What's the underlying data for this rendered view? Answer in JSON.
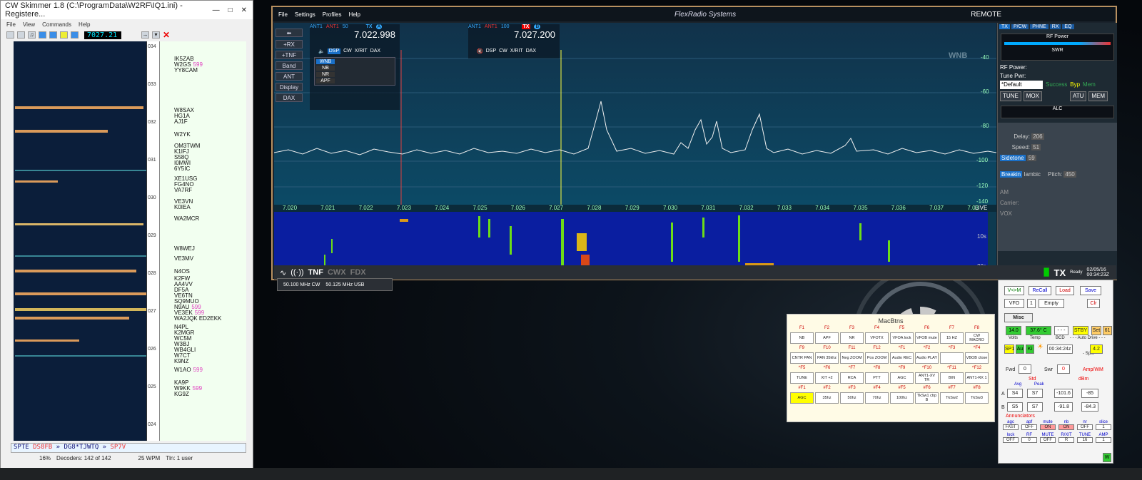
{
  "skimmer": {
    "title": "CW Skimmer 1.8 (C:\\ProgramData\\W2RF\\IQ1.ini) - Registere...",
    "menu": [
      "File",
      "View",
      "Commands",
      "Help"
    ],
    "freq": "7027.21",
    "scale_ticks": [
      "034",
      "033",
      "032",
      "031",
      "030",
      "029",
      "028",
      "027",
      "026",
      "025",
      "024"
    ],
    "calls": [
      {
        "call": "IK5ZAB",
        "snr": ""
      },
      {
        "call": "W2GS",
        "snr": "599"
      },
      {
        "call": "YY8CAM",
        "snr": ""
      },
      {
        "call": "W8SAX",
        "snr": ""
      },
      {
        "call": "HG1A",
        "snr": ""
      },
      {
        "call": "AJ1F",
        "snr": ""
      },
      {
        "call": "W2YK",
        "snr": ""
      },
      {
        "call": "OM3TWM",
        "snr": ""
      },
      {
        "call": "K1IFJ",
        "snr": ""
      },
      {
        "call": "S58Q",
        "snr": ""
      },
      {
        "call": "I0MWI",
        "snr": ""
      },
      {
        "call": "6Y5IC",
        "snr": ""
      },
      {
        "call": "XE1USG",
        "snr": ""
      },
      {
        "call": "FG4NO",
        "snr": ""
      },
      {
        "call": "VA7RF",
        "snr": ""
      },
      {
        "call": "VE3VN",
        "snr": ""
      },
      {
        "call": "K0IEA",
        "snr": ""
      },
      {
        "call": "WA2MCR",
        "snr": ""
      },
      {
        "call": "W8WEJ",
        "snr": ""
      },
      {
        "call": "VE3MV",
        "snr": ""
      },
      {
        "call": "N4OS",
        "snr": ""
      },
      {
        "call": "K2FW",
        "snr": ""
      },
      {
        "call": "AA4VV",
        "snr": ""
      },
      {
        "call": "DF5A",
        "snr": ""
      },
      {
        "call": "VE6TN",
        "snr": ""
      },
      {
        "call": "SQ9MUO",
        "snr": ""
      },
      {
        "call": "N9AU",
        "snr": "599"
      },
      {
        "call": "VE3EK",
        "snr": "599"
      },
      {
        "call": "WA2JQK ED2EKK",
        "snr": ""
      },
      {
        "call": "N4PL",
        "snr": ""
      },
      {
        "call": "K2MGR",
        "snr": ""
      },
      {
        "call": "WC5M",
        "snr": ""
      },
      {
        "call": "W3BJ",
        "snr": ""
      },
      {
        "call": "WB4GLI",
        "snr": ""
      },
      {
        "call": "W7CT",
        "snr": ""
      },
      {
        "call": "K9NZ",
        "snr": ""
      },
      {
        "call": "W1AO",
        "snr": "599"
      },
      {
        "call": "KA9P",
        "snr": ""
      },
      {
        "call": "W9KK",
        "snr": "599"
      },
      {
        "call": "KG9Z",
        "snr": ""
      }
    ],
    "decode_line": [
      "SPTE",
      "DS8FB",
      "»",
      "DG8*TJWTQ",
      "»",
      "SP7V"
    ],
    "status": {
      "cpu": "16%",
      "decoders": "Decoders: 142 of 142",
      "wpm": "25 WPM",
      "tln": "Tln: 1 user"
    }
  },
  "flex": {
    "menu": [
      "File",
      "Settings",
      "Profiles",
      "Help"
    ],
    "brand": "FlexRadio Systems",
    "remote": "REMOTE",
    "tabs": [
      "TX",
      "P/CW",
      "PHNE",
      "RX",
      "EQ"
    ],
    "side_buttons": [
      "+RX",
      "+TNF",
      "Band",
      "ANT",
      "Display",
      "DAX"
    ],
    "sliceA": {
      "ant1": "ANT1",
      "ant2": "ANT1",
      "num": "50",
      "tx": "TX",
      "letter": "A",
      "freq": "7.022.998",
      "row": [
        "DSP",
        "CW",
        "X/RIT",
        "DAX"
      ]
    },
    "sliceB": {
      "ant1": "ANT1",
      "ant2": "ANT1",
      "num": "100",
      "tx": "TX",
      "letter": "B",
      "freq": "7.027.200",
      "row": [
        "DSP",
        "CW",
        "X/RIT",
        "DAX"
      ]
    },
    "dsp": [
      "WNB",
      "NB",
      "NR",
      "APF"
    ],
    "wnb": "WNB",
    "db_labels": [
      "-40",
      "-60",
      "-80",
      "-100",
      "-120",
      "-140"
    ],
    "freq_labels": [
      "7.020",
      "7.021",
      "7.022",
      "7.023",
      "7.024",
      "7.025",
      "7.026",
      "7.027",
      "7.028",
      "7.029",
      "7.030",
      "7.031",
      "7.032",
      "7.033",
      "7.034",
      "7.035",
      "7.036",
      "7.037",
      "7.03"
    ],
    "live": "LIVE",
    "time_labels": [
      "10s",
      "20s"
    ],
    "bottom": [
      "TNF",
      "CWX",
      "FDX"
    ],
    "tx_ready": "TX",
    "ready": "Ready",
    "date": "02/05/16",
    "time": "00:34:23Z",
    "rp": {
      "rfpower": "RF Power",
      "swr": "SWR",
      "rfp": "RF Power:",
      "tune": "Tune Pwr:",
      "profile": "*Default",
      "succ": "Success",
      "byp": "Byp",
      "mem": "Mem",
      "btns": [
        "TUNE",
        "MOX",
        "ATU",
        "MEM"
      ],
      "alc": "ALC",
      "delay": "Delay:",
      "delay_v": "206",
      "speed": "Speed:",
      "speed_v": "51",
      "sidetone": "Sidetone",
      "sidetone_v": "59",
      "breakin": "Breakin",
      "iambic": "Iambic",
      "pitch": "Pitch:",
      "pitch_v": "450",
      "am": "AM",
      "carrier": "Carrier:",
      "vox": "VOX"
    }
  },
  "band": {
    "a": "50.100 MHz CW",
    "b": "50.125 MHz USB"
  },
  "macbtns": {
    "title": "MacBtns",
    "rows": [
      {
        "f": [
          "F1",
          "F2",
          "F3",
          "F4",
          "F5",
          "F6",
          "F7",
          "F8"
        ],
        "b": [
          "NB",
          "APF",
          "NR",
          "VFOTX",
          "VFOA lock",
          "VFOB mute",
          "15 HZ",
          "CW MACRO"
        ]
      },
      {
        "f": [
          "F9",
          "F10",
          "F11",
          "F12",
          "^F1",
          "^F2",
          "^F3",
          "^F4"
        ],
        "b": [
          "CNTR PAN",
          "PAN 35khz",
          "Neg ZOOM",
          "Pos ZOOM",
          "Audio REC",
          "Audio PLAY",
          "",
          "VBOB close"
        ]
      },
      {
        "f": [
          "^F5",
          "^F6",
          "^F7",
          "^F8",
          "^F9",
          "^F10",
          "^F11",
          "^F12"
        ],
        "b": [
          "TUNE",
          "XIT +2",
          "RCA",
          "PTT",
          "AGC",
          "ANT1-XV TR",
          "BIN",
          "ANT1-RX 1"
        ]
      },
      {
        "f": [
          "#F1",
          "#F2",
          "#F3",
          "#F4",
          "#F5",
          "#F6",
          "#F7",
          "#F8"
        ],
        "b": [
          "AGC",
          "35hz",
          "50hz",
          "70hz",
          "100hz",
          "TkSw1 ctrp B",
          "TkSw2",
          "TkSw3"
        ]
      }
    ]
  },
  "rp2": {
    "vm": "V<>M",
    "recall": "ReCall",
    "load": "Load",
    "save": "Save",
    "vfo": "VFO",
    "one": "1",
    "empty": "Empty",
    "clr": "Clr",
    "misc": "Misc",
    "volts": "14.0",
    "temp": "37.6° C",
    "dashes": "- - -",
    "stby": "STBY",
    "set": "Set",
    "s1": "61",
    "volts_l": "Volts",
    "temp_l": "Temp",
    "bcd_l": "BCD",
    "autodrive": "- - - Auto Drive - - -",
    "sp": "SP1",
    "au": "Au",
    "ki": "Ki",
    "clock": "00:34:24z",
    "split": "- Split -",
    "val42": "4.2",
    "fwd": "Fwd",
    "fwd_v": "0",
    "swr": "Swr",
    "swr_v": "0",
    "ampwm": "Amp/WM",
    "std": "Std",
    "dbm": "dBm",
    "avg": "Avg",
    "peak": "Peak",
    "a": "A",
    "a1": "S4",
    "a2": "S7",
    "a3": "-101.6",
    "a4": "-85",
    "b": "B",
    "b1": "S5",
    "b2": "S7",
    "b3": "-91.8",
    "b4": "-84.3",
    "annun": "Annunciators",
    "an1": [
      "agc",
      "apf",
      "mute",
      "nb",
      "nr",
      "slice"
    ],
    "an1v": [
      "FAST",
      "OFF",
      "ON",
      "ON",
      "OFF",
      "1"
    ],
    "an2": [
      "lock",
      "RF",
      "MUTE",
      "R/XIT",
      "TUNE",
      "AMP"
    ],
    "an2v": [
      "OFF",
      "0",
      "OFF",
      "R",
      "16",
      "1"
    ],
    "w": "W"
  }
}
